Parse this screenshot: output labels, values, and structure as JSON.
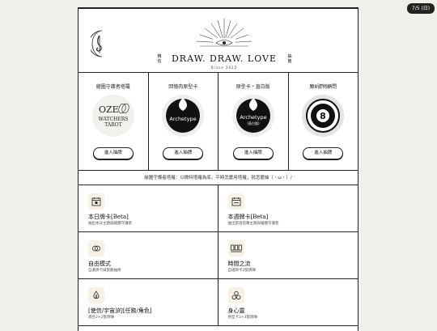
{
  "page_indicator": "7/5 (日)",
  "header": {
    "brand_title": "DRAW. DRAW. LOVE",
    "since": "Since 2022",
    "side_left": "韓信",
    "side_right": "抽籤"
  },
  "cards": [
    {
      "title": "繪圖守護者塔羅",
      "button": "進入抽牌",
      "logo_text_1": "OZE",
      "logo_text_2": "WATCHERS",
      "logo_text_3": "TAROT"
    },
    {
      "title": "回憶肉原型卡",
      "button": "進入抽牌",
      "logo_text": "Archetype"
    },
    {
      "title": "原型卡・直白版",
      "button": "進入抽牌",
      "logo_text": "Archetype",
      "logo_sub": "(直白版)"
    },
    {
      "title": "魔8號物顧問",
      "button": "進入抽牌",
      "logo_text": "8"
    }
  ],
  "notice": "繪圖守護者塔羅：以微特塔羅為底，平時怎麼用塔羅，就怎麼抽（・ω・）/",
  "features": [
    {
      "title": "本日牌卡[Beta]",
      "desc": "抽出本日主題與繪圖守護者",
      "icon": "calendar-day-icon"
    },
    {
      "title": "本週牌卡[Beta]",
      "desc": "抽出當週塔羅主題與繪圖守護者",
      "icon": "calendar-week-icon"
    },
    {
      "title": "自由模式",
      "desc": "自選牌卡與張數抽牌",
      "icon": "rings-icon"
    },
    {
      "title": "時間之流",
      "desc": "自選牌卡3張牌陣",
      "icon": "three-cards-icon"
    },
    {
      "title": "[使信/宇宙]的[任務/角色]",
      "desc": "適合2+2張牌陣",
      "icon": "flame-icon"
    },
    {
      "title": "身心靈",
      "desc": "原型卡3+3張牌陣",
      "icon": "circles-icon"
    }
  ]
}
